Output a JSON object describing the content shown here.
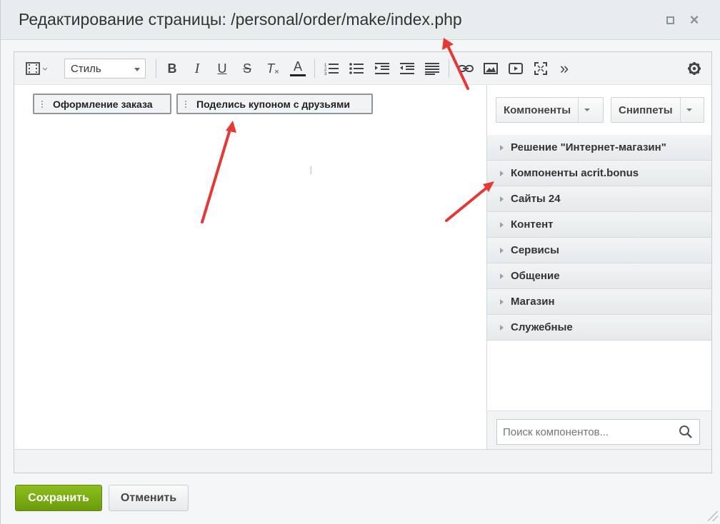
{
  "window": {
    "title": "Редактирование страницы: /personal/order/make/index.php",
    "maximize_icon": "maximize-icon",
    "close_icon": "close-icon"
  },
  "toolbar": {
    "view_icon": "film-strip-icon",
    "style_select_value": "Стиль",
    "buttons": [
      {
        "name": "bold",
        "label": "B"
      },
      {
        "name": "italic",
        "label": "I"
      },
      {
        "name": "underline",
        "label": "U"
      },
      {
        "name": "strikethrough",
        "label": "S"
      },
      {
        "name": "remove-format",
        "label": "T"
      },
      {
        "name": "font-color",
        "label": "A"
      }
    ],
    "more_label": "»"
  },
  "editor": {
    "components": [
      {
        "label": "Оформление заказа"
      },
      {
        "label": "Поделись купоном с друзьями"
      }
    ]
  },
  "sidebar": {
    "components_button": "Компоненты",
    "snippets_button": "Сниппеты",
    "groups": [
      {
        "label": "Решение \"Интернет-магазин\""
      },
      {
        "label": "Компоненты acrit.bonus"
      },
      {
        "label": "Сайты 24"
      },
      {
        "label": "Контент"
      },
      {
        "label": "Сервисы"
      },
      {
        "label": "Общение"
      },
      {
        "label": "Магазин"
      },
      {
        "label": "Служебные"
      }
    ],
    "search_placeholder": "Поиск компонентов..."
  },
  "footer": {
    "save_label": "Сохранить",
    "cancel_label": "Отменить"
  },
  "colors": {
    "save_green": "#7aab12",
    "annotation_red": "#e53935"
  }
}
